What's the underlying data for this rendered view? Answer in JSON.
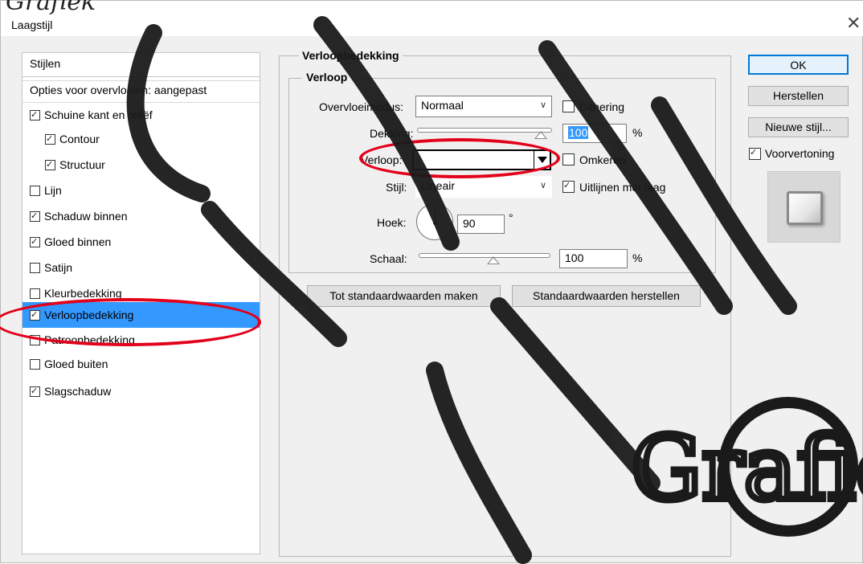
{
  "window": {
    "title": "Laagstijl",
    "close_glyph": "✕"
  },
  "watermark_text": "Grafiek",
  "styles_panel": {
    "header": "Stijlen",
    "blending_options": "Opties voor overvloeien: aangepast",
    "items": [
      {
        "label": "Schuine kant en reliëf",
        "checked": true,
        "indent": false
      },
      {
        "label": "Contour",
        "checked": true,
        "indent": true
      },
      {
        "label": "Structuur",
        "checked": true,
        "indent": true
      },
      {
        "label": "Lijn",
        "checked": false,
        "indent": false
      },
      {
        "label": "Schaduw binnen",
        "checked": true,
        "indent": false
      },
      {
        "label": "Gloed binnen",
        "checked": true,
        "indent": false
      },
      {
        "label": "Satijn",
        "checked": false,
        "indent": false
      },
      {
        "label": "Kleurbedekking",
        "checked": false,
        "indent": false
      },
      {
        "label": "Verloopbedekking",
        "checked": true,
        "indent": false,
        "selected": true
      },
      {
        "label": "Patroonbedekking",
        "checked": false,
        "indent": false
      },
      {
        "label": "Gloed buiten",
        "checked": false,
        "indent": false
      },
      {
        "label": "Slagschaduw",
        "checked": true,
        "indent": false
      }
    ]
  },
  "section": {
    "outer_title": "Verloopbedekking",
    "inner_title": "Verloop",
    "blend_mode_label": "Overvloeimodus:",
    "blend_mode_value": "Normaal",
    "dither_label": "Dithering",
    "dither_checked": false,
    "opacity_label": "Dekking:",
    "opacity_value": "100",
    "opacity_unit": "%",
    "gradient_label": "Verloop:",
    "reverse_label": "Omkeren",
    "reverse_checked": false,
    "style_label": "Stijl:",
    "style_value": "Lineair",
    "align_label": "Uitlijnen met laag",
    "align_checked": true,
    "angle_label": "Hoek:",
    "angle_value": "90",
    "angle_unit": "°",
    "scale_label": "Schaal:",
    "scale_value": "100",
    "scale_unit": "%",
    "make_default_btn": "Tot standaardwaarden maken",
    "reset_default_btn": "Standaardwaarden herstellen"
  },
  "right_buttons": {
    "ok": "OK",
    "reset": "Herstellen",
    "new_style": "Nieuwe stijl...",
    "preview_label": "Voorvertoning",
    "preview_checked": true
  },
  "accent_colors": {
    "selection": "#3399ff",
    "annotation": "#e3001b",
    "focus": "#0078d7"
  }
}
